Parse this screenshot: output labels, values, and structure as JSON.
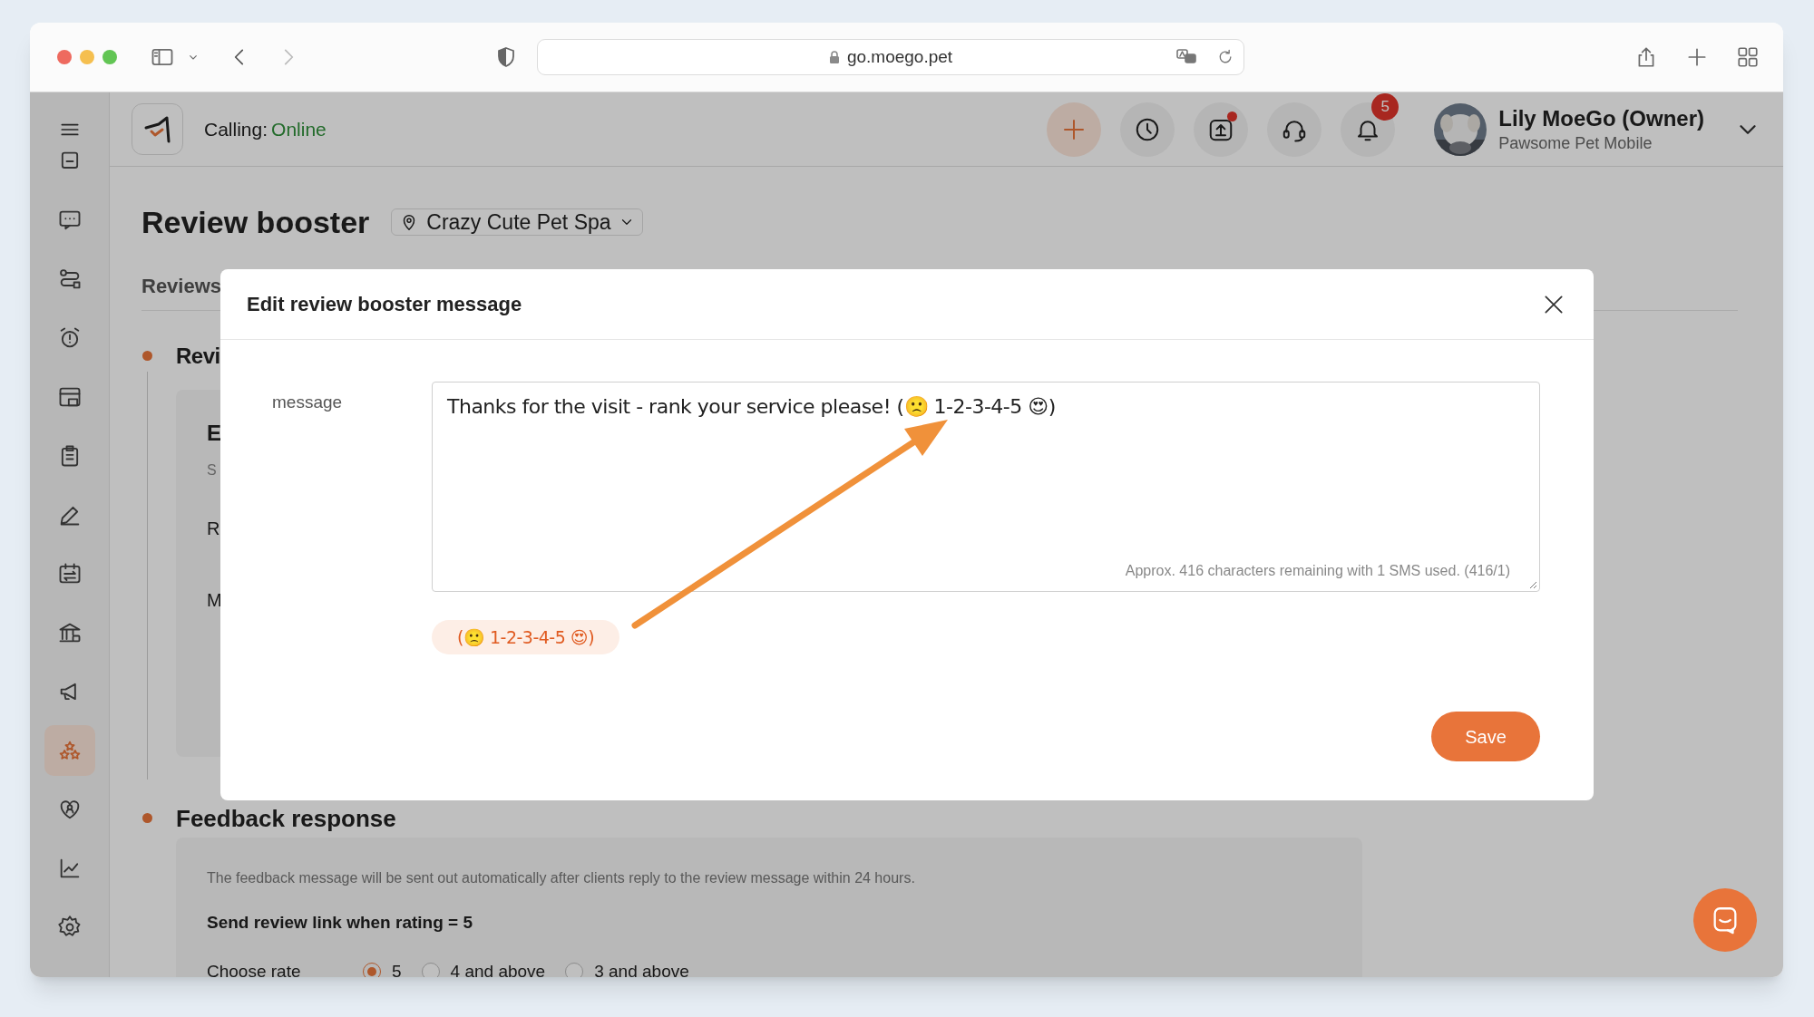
{
  "browser": {
    "url": "go.moego.pet"
  },
  "header": {
    "calling_label": "Calling:",
    "calling_status": "Online",
    "actions": [
      {
        "kind": "add",
        "alert": false
      },
      {
        "kind": "clock",
        "alert": false
      },
      {
        "kind": "upload",
        "alert": true
      },
      {
        "kind": "headset",
        "alert": false
      },
      {
        "kind": "bell",
        "alert": false,
        "badge": "5"
      }
    ],
    "user": {
      "name": "Lily MoeGo (Owner)",
      "business": "Pawsome Pet Mobile"
    }
  },
  "sidebar": {
    "items": [
      {
        "kind": "inbox",
        "selected": false
      },
      {
        "kind": "chat",
        "selected": false
      },
      {
        "kind": "route",
        "selected": false
      },
      {
        "kind": "alarm",
        "selected": false
      },
      {
        "kind": "store",
        "selected": false
      },
      {
        "kind": "clipboard",
        "selected": false
      },
      {
        "kind": "pen",
        "selected": false
      },
      {
        "kind": "exchange",
        "selected": false
      },
      {
        "kind": "bank",
        "selected": false
      },
      {
        "kind": "megaphone",
        "selected": false
      },
      {
        "kind": "stars",
        "selected": true
      },
      {
        "kind": "heart",
        "selected": false
      },
      {
        "kind": "chart",
        "selected": false
      },
      {
        "kind": "gear",
        "selected": false
      }
    ]
  },
  "page": {
    "title": "Review booster",
    "location": "Crazy Cute Pet Spa",
    "tab": "Reviews",
    "review_section": {
      "title": "Revi",
      "lines": [
        {
          "kind": "heading",
          "text": "E"
        },
        {
          "kind": "note",
          "text": "S"
        },
        {
          "kind": "label",
          "text": "R"
        },
        {
          "kind": "label",
          "text": "M"
        }
      ]
    },
    "feedback_section": {
      "title": "Feedback response",
      "description": "The feedback message will be sent out automatically after clients reply to the review message within 24 hours.",
      "rule": "Send review link when rating = 5",
      "choose_label": "Choose rate",
      "options": [
        {
          "label": "5",
          "selected": true
        },
        {
          "label": "4 and above",
          "selected": false
        },
        {
          "label": "3 and above",
          "selected": false
        }
      ]
    }
  },
  "modal": {
    "title": "Edit review booster message",
    "field_label": "message",
    "message": "Thanks for the visit - rank your service please! (🙁 1-2-3-4-5 😍)",
    "counter": "Approx. 416 characters remaining with 1 SMS used. (416/1)",
    "tag": "(🙁 1-2-3-4-5 😍)",
    "save": "Save"
  }
}
